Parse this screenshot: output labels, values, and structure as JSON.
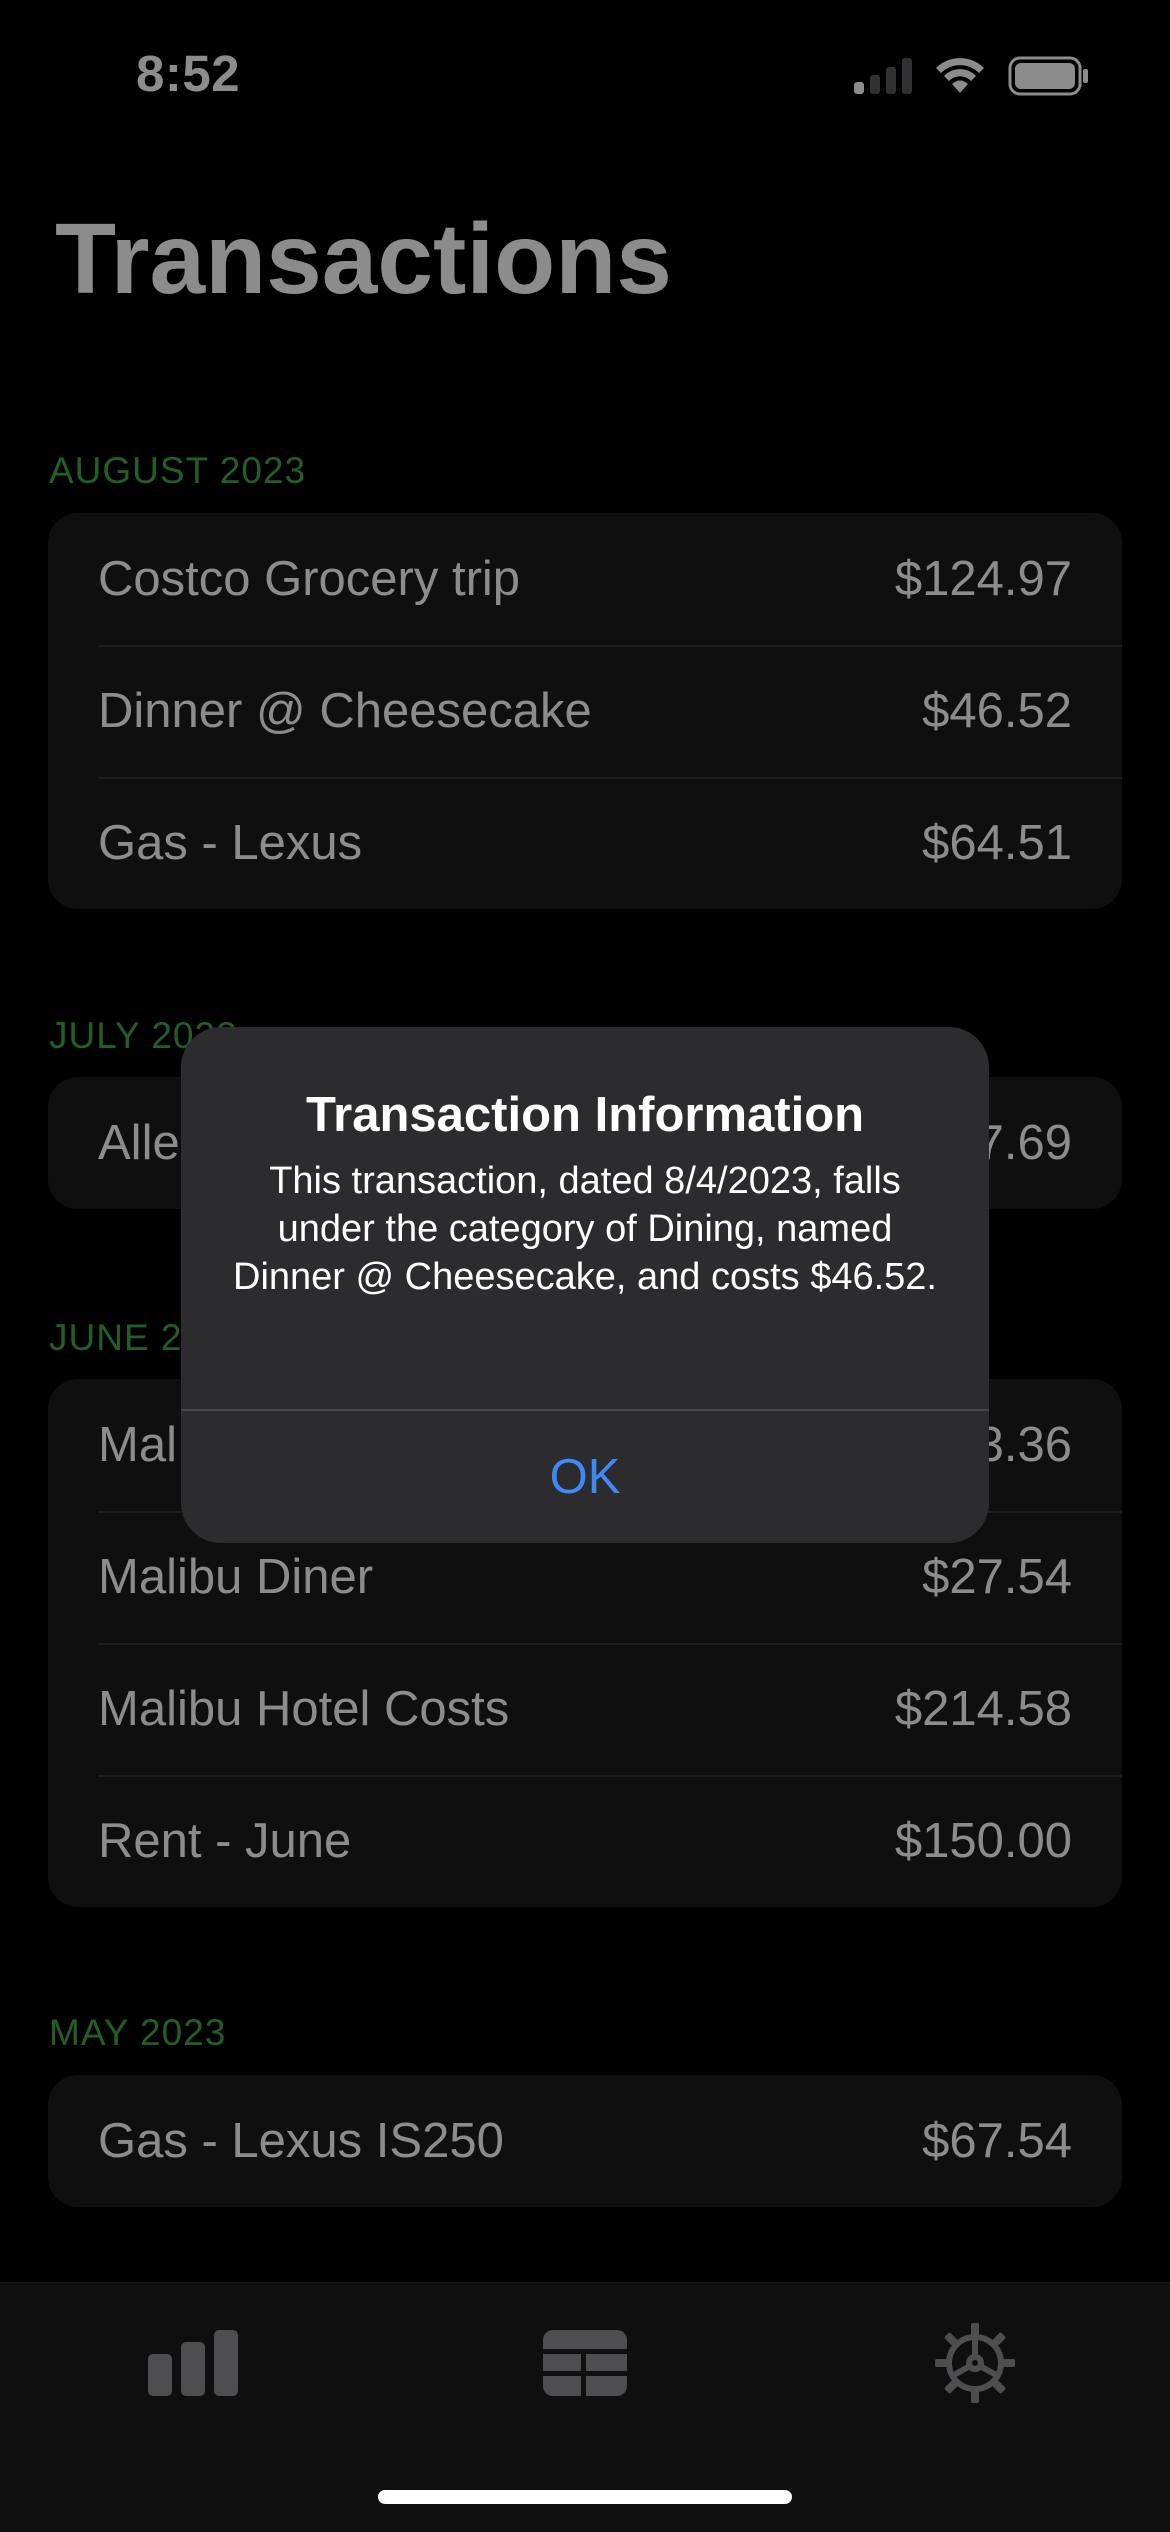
{
  "status_bar": {
    "time": "8:52",
    "icons": [
      "cellular-signal-icon",
      "wifi-icon",
      "battery-icon"
    ]
  },
  "header": {
    "title": "Transactions"
  },
  "sections": [
    {
      "label": "AUGUST 2023",
      "transactions": [
        {
          "name": "Costco Grocery trip",
          "amount": "$124.97"
        },
        {
          "name": "Dinner @ Cheesecake",
          "amount": "$46.52"
        },
        {
          "name": "Gas - Lexus",
          "amount": "$64.51"
        }
      ]
    },
    {
      "label": "JULY 2023",
      "transactions": [
        {
          "name": "Alle",
          "amount": "7.69"
        }
      ]
    },
    {
      "label": "JUNE 2023",
      "transactions": [
        {
          "name": "Mal",
          "amount": "3.36"
        },
        {
          "name": "Malibu Diner",
          "amount": "$27.54"
        },
        {
          "name": "Malibu Hotel Costs",
          "amount": "$214.58"
        },
        {
          "name": "Rent - June",
          "amount": "$150.00"
        }
      ]
    },
    {
      "label": "MAY 2023",
      "transactions": [
        {
          "name": "Gas - Lexus IS250",
          "amount": "$67.54"
        }
      ]
    }
  ],
  "tab_bar": {
    "tabs": [
      {
        "icon": "bar-chart-icon",
        "selected": false
      },
      {
        "icon": "table-list-icon",
        "selected": true
      },
      {
        "icon": "settings-gear-icon",
        "selected": false
      }
    ]
  },
  "alert": {
    "title": "Transaction Information",
    "message": "This transaction, dated 8/4/2023, falls under the category of Dining, named Dinner @ Cheesecake, and costs $46.52.",
    "ok_label": "OK"
  },
  "colors": {
    "background": "#000000",
    "card": "#1c1c1e",
    "section_header": "#3fae48",
    "alert_background": "#2c2c2e",
    "accent_blue": "#3d8af7",
    "tab_icon": "#8e8e93"
  }
}
